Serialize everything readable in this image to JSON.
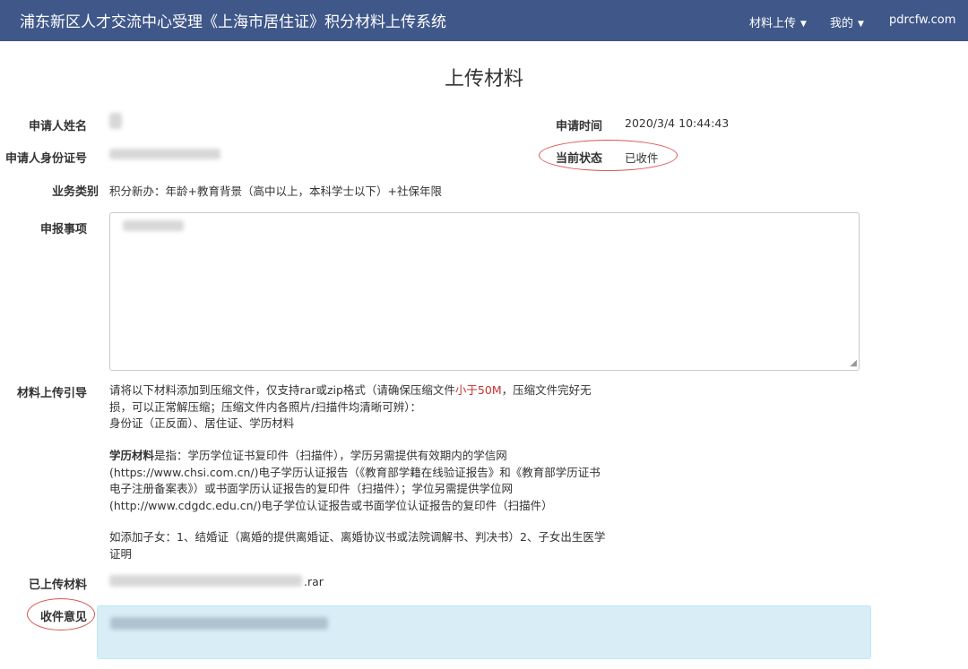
{
  "navbar": {
    "brand": "浦东新区人才交流中心受理《上海市居住证》积分材料上传系统",
    "menu_upload": "材料上传",
    "menu_mine": "我的",
    "site": "pdrcfw.com"
  },
  "page_title": "上传材料",
  "fields": {
    "name_label": "申请人姓名",
    "id_label": "申请人身份证号",
    "type_label": "业务类别",
    "type_value": "积分新办：年龄+教育背景（高中以上，本科学士以下）+社保年限",
    "apply_time_label": "申请时间",
    "apply_time_value": "2020/3/4 10:44:43",
    "status_label": "当前状态",
    "status_value": "已收件",
    "matter_label": "申报事项",
    "guide_label": "材料上传引导",
    "uploaded_label": "已上传材料",
    "uploaded_ext": ".rar",
    "comment_label": "收件意见"
  },
  "guide": {
    "p1_pre": "请将以下材料添加到压缩文件，仅支持rar或zip格式（请确保压缩文件",
    "p1_red": "小于50M",
    "p1_post": "，压缩文件完好无损，可以正常解压缩；压缩文件内各照片/扫描件均清晰可辨）：",
    "p1_list": "身份证（正反面）、居住证、学历材料",
    "p2_bold": "学历材料",
    "p2_text": "是指：学历学位证书复印件（扫描件），学历另需提供有效期内的学信网(https://www.chsi.com.cn/)电子学历认证报告（《教育部学籍在线验证报告》和《教育部学历证书电子注册备案表》）或书面学历认证报告的复印件（扫描件）；学位另需提供学位网(http://www.cdgdc.edu.cn/)电子学位认证报告或书面学位认证报告的复印件（扫描件）",
    "p3": "如添加子女：1、结婚证（离婚的提供离婚证、离婚协议书或法院调解书、判决书）2、子女出生医学证明"
  },
  "colors": {
    "navbar_bg": "#3f5789",
    "comment_bg": "#d9edf7",
    "highlight_red": "#c9302c"
  }
}
